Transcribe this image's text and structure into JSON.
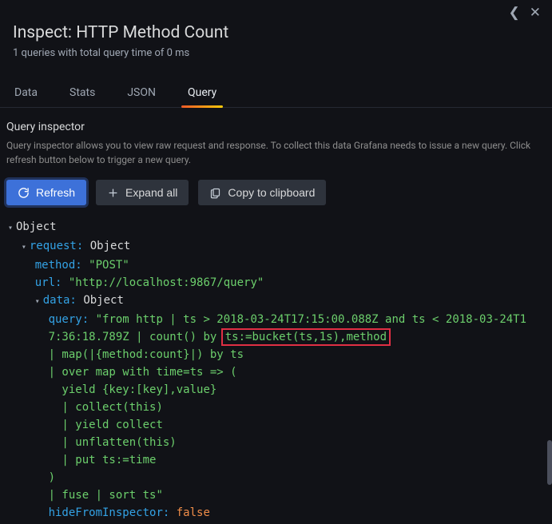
{
  "title": "Inspect: HTTP Method Count",
  "subtitle": "1 queries with total query time of 0 ms",
  "tabs": [
    "Data",
    "Stats",
    "JSON",
    "Query"
  ],
  "active_tab": "Query",
  "inspector": {
    "title": "Query inspector",
    "description": "Query inspector allows you to view raw request and response. To collect this data Grafana needs to issue a new query. Click refresh button below to trigger a new query."
  },
  "buttons": {
    "refresh": "Refresh",
    "expand_all": "Expand all",
    "copy": "Copy to clipboard"
  },
  "json": {
    "root": "Object",
    "request_label": "request:",
    "request_value": "Object",
    "method_label": "method:",
    "method_value": "\"POST\"",
    "url_label": "url:",
    "url_value": "\"http://localhost:9867/query\"",
    "data_label": "data:",
    "data_value": "Object",
    "query_label": "query:",
    "query_line1_pre": "\"from http | ts > 2018-03-24T17:15:00.088Z and ts < 2018-03-24T1",
    "query_line2_pre": "7:36:18.789Z | count() by ",
    "query_highlight": "ts:=bucket(ts,1s),method",
    "query_line3": "| map(|{method:count}|) by ts",
    "query_line4": "| over map with time=ts => (",
    "query_line5": "  yield {key:[key],value}",
    "query_line6": "  | collect(this)",
    "query_line7": "  | yield collect",
    "query_line8": "  | unflatten(this)",
    "query_line9": "  | put ts:=time",
    "query_line10": ")",
    "query_line11": "| fuse | sort ts\"",
    "hide_label": "hideFromInspector:",
    "hide_value": "false"
  }
}
